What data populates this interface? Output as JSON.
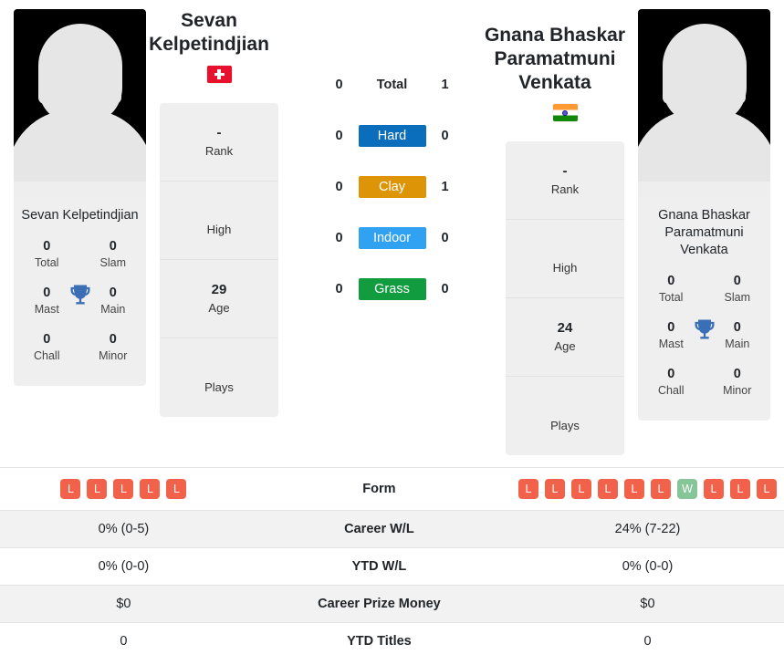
{
  "players": {
    "left": {
      "name": "Sevan Kelpetindjian",
      "card_name": "Sevan Kelpetindjian",
      "country_flag": "switzerland-flag",
      "photo": "player-photo-placeholder",
      "titles": {
        "total": {
          "value": "0",
          "label": "Total"
        },
        "slam": {
          "value": "0",
          "label": "Slam"
        },
        "mast": {
          "value": "0",
          "label": "Mast"
        },
        "main": {
          "value": "0",
          "label": "Main"
        },
        "chall": {
          "value": "0",
          "label": "Chall"
        },
        "minor": {
          "value": "0",
          "label": "Minor"
        }
      },
      "info": [
        {
          "value": "-",
          "label": "Rank"
        },
        {
          "value": "",
          "label": "High"
        },
        {
          "value": "29",
          "label": "Age"
        },
        {
          "value": "",
          "label": "Plays"
        }
      ],
      "form": [
        "L",
        "L",
        "L",
        "L",
        "L"
      ],
      "career_wl": "0% (0-5)",
      "ytd_wl": "0% (0-0)",
      "career_prize_money": "$0",
      "ytd_titles": "0"
    },
    "right": {
      "name": "Gnana Bhaskar Paramatmuni Venkata",
      "card_name": "Gnana Bhaskar Paramatmuni Venkata",
      "country_flag": "india-flag",
      "photo": "player-photo-placeholder",
      "titles": {
        "total": {
          "value": "0",
          "label": "Total"
        },
        "slam": {
          "value": "0",
          "label": "Slam"
        },
        "mast": {
          "value": "0",
          "label": "Mast"
        },
        "main": {
          "value": "0",
          "label": "Main"
        },
        "chall": {
          "value": "0",
          "label": "Chall"
        },
        "minor": {
          "value": "0",
          "label": "Minor"
        }
      },
      "info": [
        {
          "value": "-",
          "label": "Rank"
        },
        {
          "value": "",
          "label": "High"
        },
        {
          "value": "24",
          "label": "Age"
        },
        {
          "value": "",
          "label": "Plays"
        }
      ],
      "form": [
        "L",
        "L",
        "L",
        "L",
        "L",
        "L",
        "W",
        "L",
        "L",
        "L"
      ],
      "career_wl": "24% (7-22)",
      "ytd_wl": "0% (0-0)",
      "career_prize_money": "$0",
      "ytd_titles": "0"
    }
  },
  "head_to_head": [
    {
      "label": "Total",
      "left": "0",
      "right": "1",
      "style": "plain",
      "color": ""
    },
    {
      "label": "Hard",
      "left": "0",
      "right": "0",
      "style": "badge",
      "color": "#0a6ebd"
    },
    {
      "label": "Clay",
      "left": "0",
      "right": "1",
      "style": "badge",
      "color": "#dd9407"
    },
    {
      "label": "Indoor",
      "left": "0",
      "right": "0",
      "style": "badge",
      "color": "#31a2f2"
    },
    {
      "label": "Grass",
      "left": "0",
      "right": "0",
      "style": "badge",
      "color": "#119c40"
    }
  ],
  "table": {
    "rows": [
      {
        "label": "Form",
        "key": "form",
        "type": "form"
      },
      {
        "label": "Career W/L",
        "key": "career_wl",
        "type": "text"
      },
      {
        "label": "YTD W/L",
        "key": "ytd_wl",
        "type": "text"
      },
      {
        "label": "Career Prize Money",
        "key": "career_prize_money",
        "type": "text"
      },
      {
        "label": "YTD Titles",
        "key": "ytd_titles",
        "type": "text"
      }
    ]
  },
  "colors": {
    "loss_badge": "#f2614a",
    "win_badge": "#86c598",
    "trophy": "#3b6fb5",
    "card_bg": "#efefef",
    "alt_row": "#f2f2f2"
  }
}
